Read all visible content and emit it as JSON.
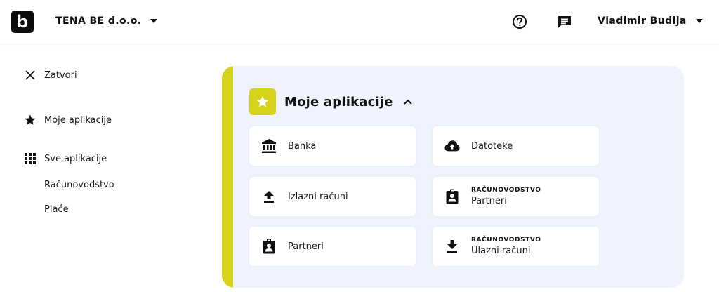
{
  "header": {
    "logo_letter": "b",
    "company": "TENA BE d.o.o.",
    "user": "Vladimir Budija",
    "icons": [
      "help-icon",
      "chat-icon"
    ]
  },
  "sidebar": {
    "close_label": "Zatvori",
    "my_apps_label": "Moje aplikacije",
    "all_apps_label": "Sve aplikacije",
    "sub_items": [
      "Računovodstvo",
      "Plaće"
    ]
  },
  "panel": {
    "title": "Moje aplikacije",
    "accent_color": "#d6d31b",
    "background_color": "#eef3fd",
    "cards": [
      {
        "label": "Banka",
        "kicker": "",
        "icon": "bank-icon"
      },
      {
        "label": "Datoteke",
        "kicker": "",
        "icon": "cloud-upload-icon"
      },
      {
        "label": "Izlazni računi",
        "kicker": "",
        "icon": "upload-icon"
      },
      {
        "label": "Partneri",
        "kicker": "RAČUNOVODSTVO",
        "icon": "contact-badge-icon"
      },
      {
        "label": "Partneri",
        "kicker": "",
        "icon": "contact-badge-icon"
      },
      {
        "label": "Ulazni računi",
        "kicker": "RAČUNOVODSTVO",
        "icon": "download-icon"
      }
    ]
  }
}
